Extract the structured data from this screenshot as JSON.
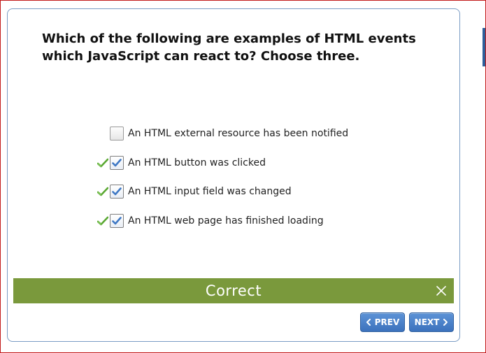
{
  "question": {
    "text": "Which of the following are examples of HTML events which JavaScript can react to? Choose three."
  },
  "options": [
    {
      "label": "An HTML external resource has been notified",
      "checked": false,
      "correct_mark": false
    },
    {
      "label": "An HTML button was clicked",
      "checked": true,
      "correct_mark": true
    },
    {
      "label": "An HTML input field was changed",
      "checked": true,
      "correct_mark": true
    },
    {
      "label": "An HTML web page has finished loading",
      "checked": true,
      "correct_mark": true
    }
  ],
  "feedback": {
    "text": "Correct",
    "color": "#7a993c"
  },
  "navigation": {
    "prev_label": "PREV",
    "next_label": "NEXT"
  },
  "colors": {
    "accent": "#3c72bd",
    "check_mark": "#3f78c4",
    "correct_tick": "#5aa832",
    "frame_border": "#c21a1a"
  },
  "icons": {
    "correct_tick": "check-icon",
    "checkbox_mark": "check-icon",
    "close": "close-icon",
    "prev": "chevron-left-icon",
    "next": "chevron-right-icon"
  }
}
